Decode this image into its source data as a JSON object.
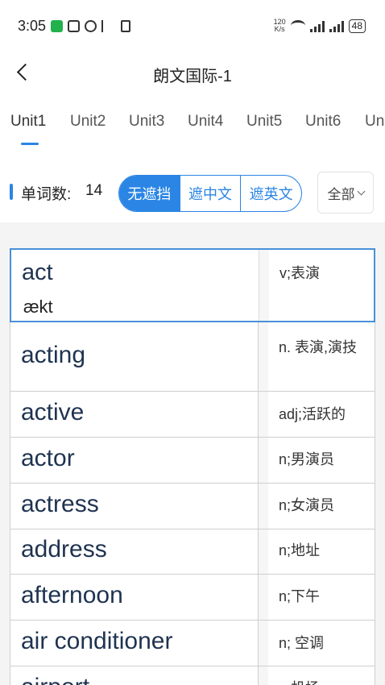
{
  "status_bar": {
    "time": "3:05",
    "net_speed_value": "120",
    "net_speed_unit": "K/s",
    "battery": "48"
  },
  "nav": {
    "title": "朗文国际-1"
  },
  "tabs": [
    {
      "label": "Unit1",
      "active": true
    },
    {
      "label": "Unit2",
      "active": false
    },
    {
      "label": "Unit3",
      "active": false
    },
    {
      "label": "Unit4",
      "active": false
    },
    {
      "label": "Unit5",
      "active": false
    },
    {
      "label": "Unit6",
      "active": false
    },
    {
      "label": "Un",
      "active": false
    }
  ],
  "toolbar": {
    "count_label": "单词数:",
    "count_value": "14",
    "modes": [
      {
        "label": "无遮挡",
        "active": true
      },
      {
        "label": "遮中文",
        "active": false
      },
      {
        "label": "遮英文",
        "active": false
      }
    ],
    "filter_label": "全部"
  },
  "words": [
    {
      "word": "act",
      "phonetic": "ækt",
      "definition": "v;表演"
    },
    {
      "word": "acting",
      "definition": "n. 表演,演技"
    },
    {
      "word": "active",
      "definition": "adj;活跃的"
    },
    {
      "word": "actor",
      "definition": "n;男演员"
    },
    {
      "word": "actress",
      "definition": "n;女演员"
    },
    {
      "word": "address",
      "definition": "n;地址"
    },
    {
      "word": "afternoon",
      "definition": "n;下午"
    },
    {
      "word": "air conditioner",
      "definition": "n; 空调"
    },
    {
      "word": "airport",
      "definition": "n;机场"
    }
  ],
  "colors": {
    "accent": "#2b85e4",
    "word_text": "#1f3350"
  }
}
